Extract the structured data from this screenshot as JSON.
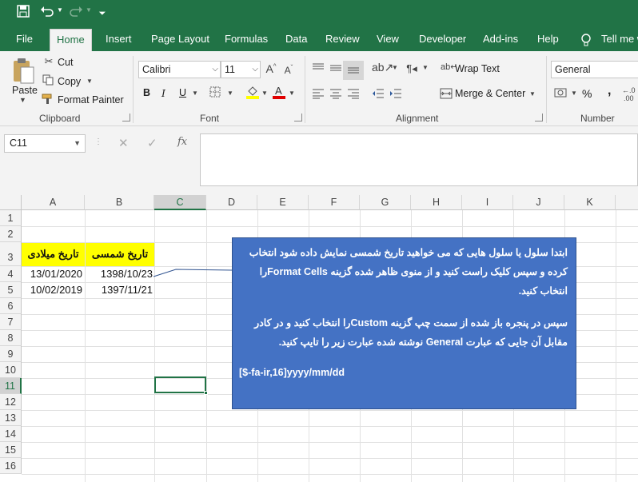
{
  "quick_access": {
    "save_icon": "save-icon",
    "undo_icon": "undo-icon",
    "redo_icon": "redo-icon",
    "customize_icon": "customize-icon"
  },
  "ribbon_tabs": [
    "File",
    "Home",
    "Insert",
    "Page Layout",
    "Formulas",
    "Data",
    "Review",
    "View",
    "Developer",
    "Add-ins",
    "Help",
    "Tell me w"
  ],
  "active_tab": "Home",
  "clipboard": {
    "paste": "Paste",
    "cut": "Cut",
    "copy": "Copy",
    "format_painter": "Format Painter",
    "group_label": "Clipboard"
  },
  "font": {
    "name": "Calibri",
    "size": "11",
    "bold": "B",
    "italic": "I",
    "underline": "U",
    "group_label": "Font"
  },
  "alignment": {
    "wrap_text": "Wrap Text",
    "merge_center": "Merge & Center",
    "group_label": "Alignment"
  },
  "number": {
    "format": "General",
    "percent": "%",
    "comma": ",",
    "group_label": "Number"
  },
  "formula_bar": {
    "name_box": "C11",
    "fx": "fx",
    "content": ""
  },
  "columns": [
    "A",
    "B",
    "C",
    "D",
    "E",
    "F",
    "G",
    "H",
    "I",
    "J",
    "K"
  ],
  "rows": [
    "1",
    "2",
    "3",
    "4",
    "5",
    "6",
    "7",
    "8",
    "9",
    "10",
    "11",
    "12",
    "13",
    "14",
    "15",
    "16"
  ],
  "cells": {
    "A3": "تاریخ میلادی",
    "B3": "تاریخ شمسی",
    "A4": "13/01/2020",
    "B4": "1398/10/23",
    "A5": "10/02/2019",
    "B5": "1397/11/21"
  },
  "selected_cell": "C11",
  "note": {
    "para1_line1": "ابتدا سلول یا سلول هایی که می خواهید تاریخ شمسی نمایش داده شود انتخاب",
    "para1_line2": "کرده و سپس کلیک راست کنید و از منوی ظاهر شده گزینه  Format Cellsرا",
    "para1_line3": "انتخاب کنید.",
    "para2_line1": "سپس در پنجره باز شده از سمت چپ گزینه  Customرا انتخاب کنید و در کادر",
    "para2_line2": "مقابل آن جایی که عبارت  General نوشته شده عبارت زیر را تایپ کنید.",
    "code": "[$-fa-ir,16]yyyy/mm/dd"
  },
  "colors": {
    "excel_green": "#217346",
    "highlight": "#ffff00",
    "note_fill": "#4472c4"
  }
}
